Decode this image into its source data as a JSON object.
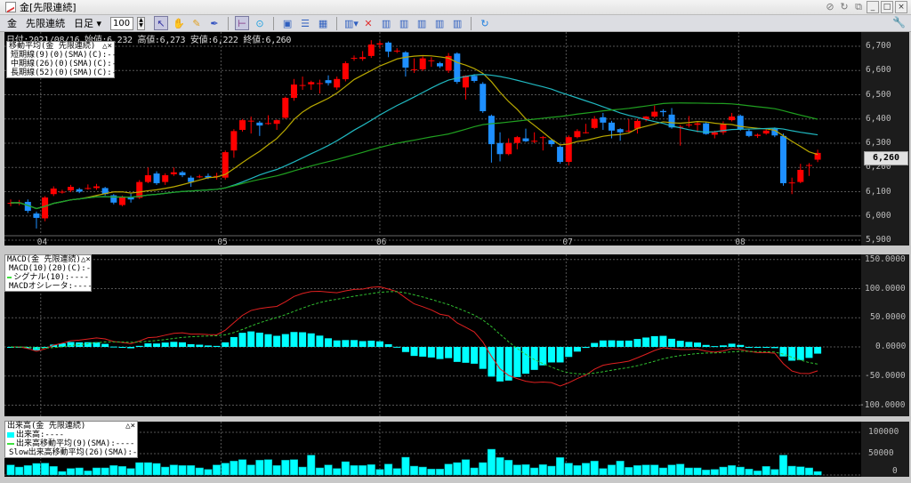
{
  "window": {
    "title": "金[先限連続]",
    "icons": [
      "unlink-icon",
      "refresh-icon",
      "duplicate-window-icon"
    ],
    "buttons": {
      "minimize": "_",
      "maximize": "□",
      "close": "×"
    }
  },
  "toolbar": {
    "symbol": "金",
    "contract": "先限連続",
    "period": "日足",
    "period_caret": "▾",
    "bars": "100",
    "icons": [
      "select-arrow-icon",
      "hand-icon",
      "pencil-icon",
      "pen-icon",
      "crosshair-icon",
      "up-circle-icon",
      "chart-window-icon",
      "grid-lines-icon",
      "table-icon",
      "indicator-dropdown-icon",
      "delete-indicator-icon",
      "indicator-1-icon",
      "indicator-2-icon",
      "indicator-3-icon",
      "indicator-4-icon",
      "indicator-5-icon",
      "reload-icon",
      "settings-wrench-icon"
    ]
  },
  "info": {
    "text": "日付:2021/08/16 始値:6,232 高値:6,273 安値:6,222 終値:6,260"
  },
  "price_panel": {
    "legend": {
      "title": "移動平均(金 先限連続)",
      "controls": "△×",
      "items": [
        {
          "label": "短期線(9)(0)(SMA)(C):----",
          "color": "#e8e030"
        },
        {
          "label": "中期線(26)(0)(SMA)(C):----",
          "color": "#40e0f0"
        },
        {
          "label": "長期線(52)(0)(SMA)(C):----",
          "color": "#40e040"
        }
      ]
    },
    "current_price": "6,260",
    "y_ticks": [
      "6,700",
      "6,600",
      "6,500",
      "6,400",
      "6,300",
      "6,200",
      "6,100",
      "6,000",
      "5,900"
    ],
    "x_ticks": [
      "04",
      "05",
      "06",
      "07",
      "08"
    ]
  },
  "macd_panel": {
    "legend": {
      "title": "MACD(金 先限連続)",
      "controls": "△×",
      "items": [
        {
          "label": "MACD(10)(20)(C):----",
          "color": "#ff4040"
        },
        {
          "label": "シグナル(10):----",
          "color": "#40e040"
        },
        {
          "label": "MACDオシレータ:----",
          "color": "#00ffff"
        }
      ]
    },
    "y_ticks": [
      "150.0000",
      "100.0000",
      "50.0000",
      "0.0000",
      "-50.0000",
      "-100.0000"
    ]
  },
  "volume_panel": {
    "legend": {
      "title": "出来高(金 先限連続)",
      "controls": "△×",
      "items": [
        {
          "label": "出来高:----",
          "color": "#00ffff"
        },
        {
          "label": "出来高移動平均(9)(SMA):----",
          "color": "#40e040"
        },
        {
          "label": "Slow出来高移動平均(26)(SMA):----",
          "color": "#ff80ff"
        }
      ]
    },
    "y_ticks": [
      "100000",
      "50000",
      "0"
    ]
  },
  "colors": {
    "up": "#ff0000",
    "down": "#1e8fff",
    "sma_short": "#b8a800",
    "sma_mid": "#20b8c0",
    "sma_long": "#20a020",
    "macd": "#e02020",
    "signal": "#30c030",
    "osc": "#00ffff",
    "volume": "#00ffff"
  },
  "chart_data": {
    "type": "candlestick",
    "month_start_index": {
      "04": 3.5,
      "05": 24.5,
      "06": 43,
      "07": 64.7,
      "08": 84.8
    },
    "ohlc": [
      [
        6054,
        6068,
        6040,
        6054
      ],
      [
        6055,
        6066,
        6044,
        6055
      ],
      [
        6058,
        6068,
        6012,
        6021
      ],
      [
        6010,
        6018,
        5948,
        5992
      ],
      [
        5990,
        6082,
        5978,
        6076
      ],
      [
        6090,
        6122,
        6082,
        6113
      ],
      [
        6100,
        6108,
        6092,
        6100
      ],
      [
        6105,
        6128,
        6098,
        6120
      ],
      [
        6110,
        6116,
        6094,
        6100
      ],
      [
        6115,
        6130,
        6108,
        6115
      ],
      [
        6115,
        6132,
        6108,
        6122
      ],
      [
        6115,
        6120,
        6084,
        6090
      ],
      [
        6085,
        6090,
        6048,
        6055
      ],
      [
        6045,
        6084,
        6040,
        6078
      ],
      [
        6080,
        6092,
        6055,
        6068
      ],
      [
        6075,
        6148,
        6070,
        6140
      ],
      [
        6140,
        6200,
        6135,
        6168
      ],
      [
        6175,
        6184,
        6128,
        6135
      ],
      [
        6140,
        6176,
        6128,
        6168
      ],
      [
        6172,
        6200,
        6165,
        6180
      ],
      [
        6180,
        6186,
        6160,
        6168
      ],
      [
        6158,
        6166,
        6120,
        6140
      ],
      [
        6163,
        6170,
        6156,
        6163
      ],
      [
        6165,
        6175,
        6152,
        6158
      ],
      [
        6165,
        6178,
        6150,
        6165
      ],
      [
        6158,
        6270,
        6150,
        6263
      ],
      [
        6270,
        6358,
        6240,
        6350
      ],
      [
        6355,
        6400,
        6348,
        6395
      ],
      [
        6393,
        6410,
        6340,
        6393
      ],
      [
        6385,
        6392,
        6330,
        6373
      ],
      [
        6383,
        6415,
        6376,
        6383
      ],
      [
        6380,
        6398,
        6355,
        6395
      ],
      [
        6405,
        6492,
        6400,
        6487
      ],
      [
        6487,
        6565,
        6475,
        6542
      ],
      [
        6540,
        6575,
        6520,
        6540
      ],
      [
        6543,
        6558,
        6520,
        6552
      ],
      [
        6548,
        6562,
        6505,
        6548
      ],
      [
        6560,
        6580,
        6538,
        6548
      ],
      [
        6530,
        6575,
        6520,
        6565
      ],
      [
        6564,
        6638,
        6555,
        6630
      ],
      [
        6652,
        6662,
        6640,
        6652
      ],
      [
        6648,
        6680,
        6640,
        6655
      ],
      [
        6660,
        6725,
        6652,
        6707
      ],
      [
        6707,
        6722,
        6690,
        6712
      ],
      [
        6715,
        6720,
        6655,
        6678
      ],
      [
        6682,
        6692,
        6672,
        6682
      ],
      [
        6675,
        6680,
        6575,
        6612
      ],
      [
        6605,
        6650,
        6590,
        6605
      ],
      [
        6605,
        6658,
        6598,
        6650
      ],
      [
        6642,
        6655,
        6615,
        6642
      ],
      [
        6630,
        6636,
        6610,
        6617
      ],
      [
        6600,
        6672,
        6590,
        6660
      ],
      [
        6670,
        6675,
        6545,
        6553
      ],
      [
        6530,
        6580,
        6480,
        6578
      ],
      [
        6578,
        6585,
        6550,
        6557
      ],
      [
        6545,
        6552,
        6425,
        6432
      ],
      [
        6413,
        6418,
        6220,
        6296
      ],
      [
        6301,
        6345,
        6225,
        6255
      ],
      [
        6255,
        6320,
        6250,
        6301
      ],
      [
        6301,
        6330,
        6275,
        6325
      ],
      [
        6320,
        6360,
        6305,
        6308
      ],
      [
        6310,
        6345,
        6300,
        6310
      ],
      [
        6325,
        6330,
        6270,
        6325
      ],
      [
        6313,
        6318,
        6285,
        6296
      ],
      [
        6285,
        6290,
        6215,
        6223
      ],
      [
        6223,
        6332,
        6208,
        6325
      ],
      [
        6325,
        6358,
        6320,
        6350
      ],
      [
        6345,
        6380,
        6340,
        6345
      ],
      [
        6363,
        6412,
        6358,
        6400
      ],
      [
        6407,
        6425,
        6355,
        6385
      ],
      [
        6385,
        6392,
        6320,
        6352
      ],
      [
        6358,
        6362,
        6310,
        6345
      ],
      [
        6352,
        6400,
        6345,
        6352
      ],
      [
        6360,
        6400,
        6340,
        6392
      ],
      [
        6398,
        6412,
        6390,
        6410
      ],
      [
        6410,
        6455,
        6405,
        6430
      ],
      [
        6433,
        6440,
        6410,
        6428
      ],
      [
        6418,
        6445,
        6360,
        6365
      ],
      [
        6368,
        6375,
        6290,
        6368
      ],
      [
        6377,
        6412,
        6365,
        6377
      ],
      [
        6376,
        6390,
        6345,
        6382
      ],
      [
        6382,
        6386,
        6335,
        6338
      ],
      [
        6335,
        6352,
        6320,
        6345
      ],
      [
        6345,
        6390,
        6335,
        6380
      ],
      [
        6395,
        6425,
        6390,
        6410
      ],
      [
        6413,
        6418,
        6352,
        6358
      ],
      [
        6350,
        6358,
        6325,
        6330
      ],
      [
        6330,
        6340,
        6322,
        6335
      ],
      [
        6340,
        6360,
        6335,
        6352
      ],
      [
        6360,
        6365,
        6325,
        6332
      ],
      [
        6330,
        6340,
        6125,
        6135
      ],
      [
        6138,
        6158,
        6090,
        6138
      ],
      [
        6140,
        6215,
        6135,
        6190
      ],
      [
        6210,
        6218,
        6165,
        6210
      ],
      [
        6232,
        6273,
        6222,
        6260
      ]
    ],
    "volume": [
      23600,
      18700,
      22200,
      27100,
      27800,
      20100,
      8300,
      15300,
      16700,
      9700,
      16700,
      16700,
      22200,
      20100,
      15300,
      29100,
      29100,
      27100,
      18700,
      23600,
      22200,
      22200,
      16700,
      13200,
      23600,
      27800,
      32600,
      36100,
      23600,
      34700,
      36100,
      22200,
      34700,
      36100,
      18700,
      46500,
      16700,
      23600,
      15300,
      31200,
      22200,
      22200,
      24300,
      13200,
      25700,
      15300,
      41600,
      20800,
      18700,
      13900,
      13900,
      25700,
      29100,
      36100,
      16700,
      29100,
      60400,
      40900,
      34700,
      23600,
      24300,
      16700,
      24300,
      20800,
      40900,
      27800,
      22200,
      27800,
      32600,
      15300,
      23600,
      32600,
      18000,
      22200,
      23600,
      23600,
      16700,
      23600,
      25700,
      16700,
      16700,
      11800,
      13200,
      18700,
      22200,
      18700,
      13900,
      9700,
      20100,
      13200,
      46500,
      20800,
      19400,
      16700,
      8300
    ],
    "sma_periods": [
      9,
      26,
      52
    ],
    "macd_params": {
      "fast": 10,
      "slow": 20,
      "signal": 10
    },
    "price_range": [
      5900,
      6700
    ],
    "macd_range": [
      -100,
      150
    ],
    "volume_range": [
      0,
      100000
    ]
  }
}
